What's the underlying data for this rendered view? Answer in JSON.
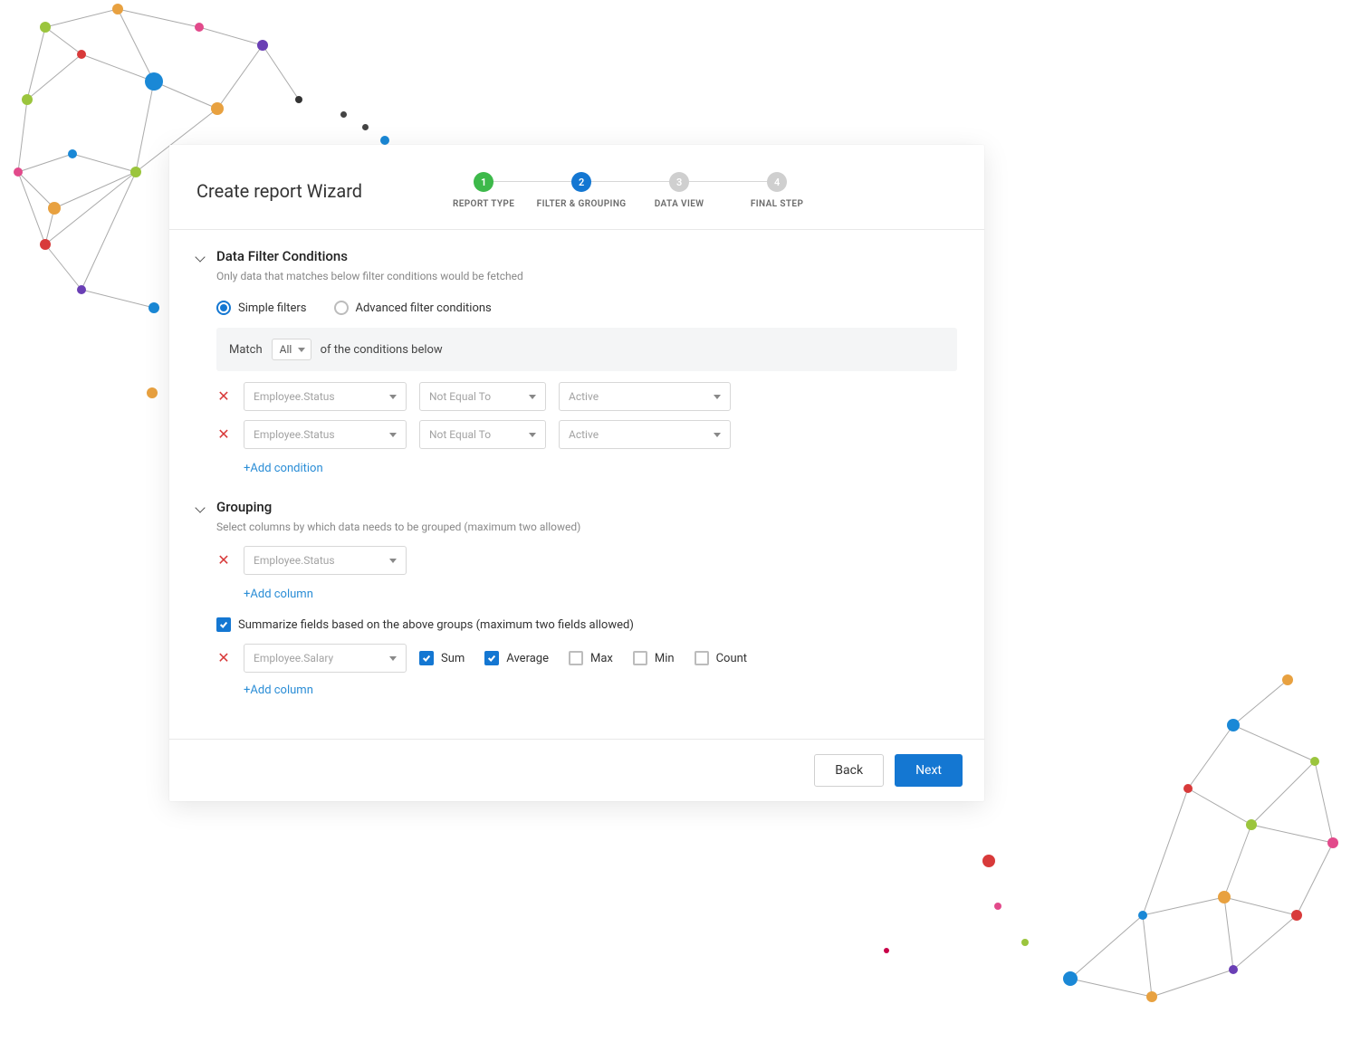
{
  "title": "Create report Wizard",
  "stepper": [
    {
      "num": "1",
      "label": "REPORT TYPE",
      "state": "done"
    },
    {
      "num": "2",
      "label": "FILTER & GROUPING",
      "state": "current"
    },
    {
      "num": "3",
      "label": "DATA VIEW",
      "state": "pending"
    },
    {
      "num": "4",
      "label": "FINAL STEP",
      "state": "pending"
    }
  ],
  "filter": {
    "heading": "Data Filter Conditions",
    "sub": "Only data that matches below filter conditions would be fetched",
    "mode_simple_label": "Simple filters",
    "mode_advanced_label": "Advanced filter conditions",
    "match_prefix": "Match",
    "match_value": "All",
    "match_suffix": "of the conditions below",
    "rows": [
      {
        "field": "Employee.Status",
        "op": "Not Equal To",
        "val": "Active"
      },
      {
        "field": "Employee.Status",
        "op": "Not Equal To",
        "val": "Active"
      }
    ],
    "add_label": "+Add condition"
  },
  "grouping": {
    "heading": "Grouping",
    "sub": "Select columns by which data needs to be grouped (maximum two allowed)",
    "rows": [
      {
        "field": "Employee.Status"
      }
    ],
    "add_label": "+Add column",
    "summarize_label": "Summarize fields based on the above groups (maximum two fields allowed)",
    "summary_field": "Employee.Salary",
    "aggs": {
      "sum": {
        "label": "Sum",
        "on": true
      },
      "avg": {
        "label": "Average",
        "on": true
      },
      "max": {
        "label": "Max",
        "on": false
      },
      "min": {
        "label": "Min",
        "on": false
      },
      "count": {
        "label": "Count",
        "on": false
      }
    },
    "add_summary_label": "+Add column"
  },
  "footer": {
    "back": "Back",
    "next": "Next"
  }
}
